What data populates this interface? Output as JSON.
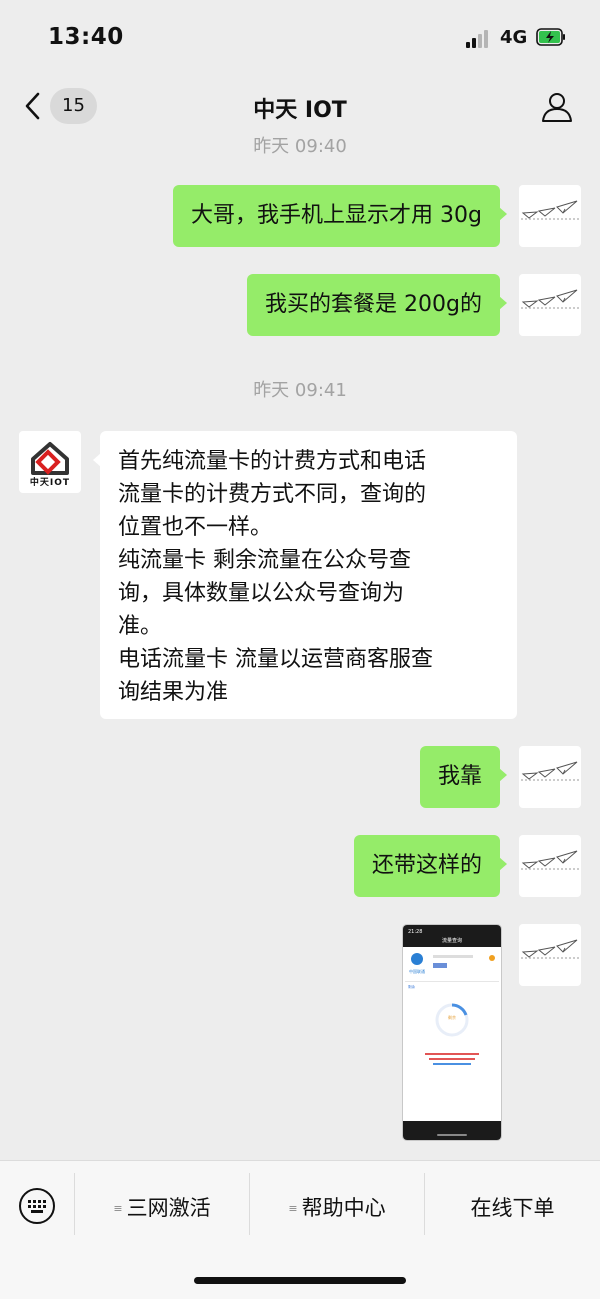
{
  "status_bar": {
    "time": "13:40",
    "network": "4G",
    "battery_charging": true
  },
  "nav": {
    "back_count": "15",
    "title": "中天 IOT"
  },
  "chat": {
    "timestamps": [
      "昨天 09:40",
      "昨天 09:41"
    ],
    "messages": [
      {
        "from": "me",
        "text": "大哥，我手机上显示才用 30g"
      },
      {
        "from": "me",
        "text": "我买的套餐是 200g的"
      },
      {
        "from": "other",
        "text": "首先纯流量卡的计费方式和电话\n流量卡的计费方式不同，查询的\n位置也不一样。\n纯流量卡 剩余流量在公众号查\n询，具体数量以公众号查询为\n准。\n电话流量卡 流量以运营商客服查\n询结果为准"
      },
      {
        "from": "me",
        "text": "我靠"
      },
      {
        "from": "me",
        "text": "还带这样的"
      }
    ],
    "other_avatar_label": "中天IOT",
    "screenshot": {
      "time": "21:28",
      "title": "流量查询",
      "brand": "中国联通",
      "labels": [
        "剩余",
        "使用情况"
      ]
    }
  },
  "bottom_menu": {
    "items": [
      {
        "label": "三网激活",
        "has_submenu": true
      },
      {
        "label": "帮助中心",
        "has_submenu": true
      },
      {
        "label": "在线下单",
        "has_submenu": false
      }
    ]
  },
  "colors": {
    "my_bubble": "#95ec69",
    "other_bubble": "#ffffff",
    "background": "#ededed"
  }
}
